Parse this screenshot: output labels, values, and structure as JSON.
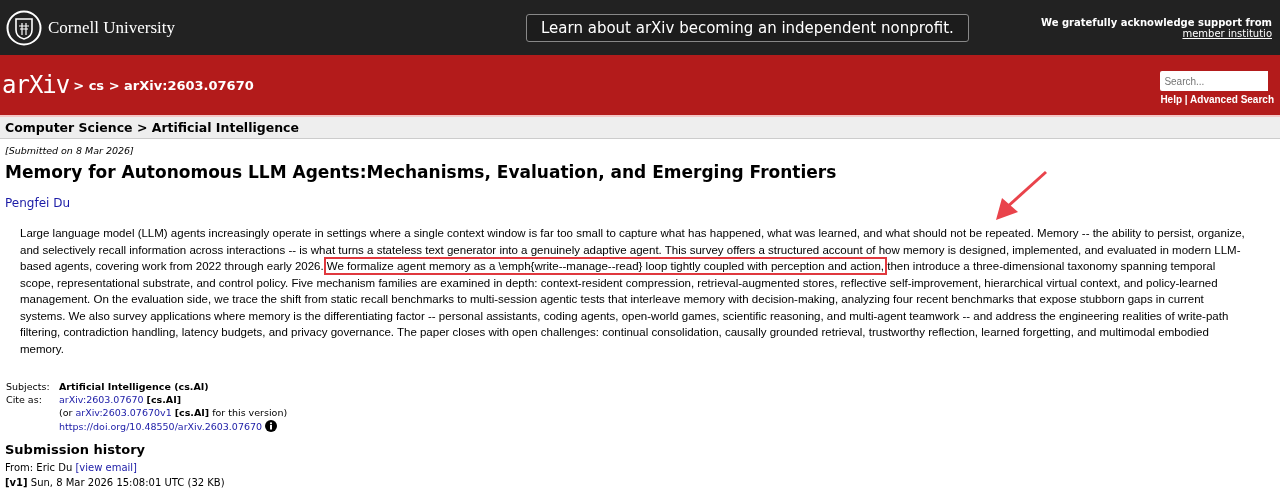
{
  "top_bar": {
    "university": "Cornell University",
    "announcement": "Learn about arXiv becoming an independent nonprofit.",
    "support_text": "We gratefully acknowledge support from",
    "support_link": "member institutio"
  },
  "header": {
    "logo": "arXiv",
    "breadcrumb": "> cs > arXiv:2603.07670",
    "search": {
      "placeholder": "Search..."
    },
    "links": [
      {
        "label": "Help"
      },
      {
        "label": "Advanced Search"
      }
    ],
    "link_separator": "|"
  },
  "subheader": "Computer Science > Artificial Intelligence",
  "dateline": "[Submitted on 8 Mar 2026]",
  "title": "Memory for Autonomous LLM Agents:Mechanisms, Evaluation, and Emerging Frontiers",
  "authors": [
    "Pengfei Du"
  ],
  "abstract": {
    "before": "Large language model (LLM) agents increasingly operate in settings where a single context window is far too small to capture what has happened, what was learned, and what should not be repeated. Memory -- the ability to persist, organize, and selectively recall information across interactions -- is what turns a stateless text generator into a genuinely adaptive agent. This survey offers a structured account of how memory is designed, implemented, and evaluated in modern LLM-based agents, covering work from 2022 through early 2026.",
    "highlighted": "We formalize agent memory as a \\emph{write--manage--read} loop tightly coupled with perception and action,",
    "after": "then introduce a three-dimensional taxonomy spanning temporal scope, representational substrate, and control policy. Five mechanism families are examined in depth: context-resident compression, retrieval-augmented stores, reflective self-improvement, hierarchical virtual context, and policy-learned management. On the evaluation side, we trace the shift from static recall benchmarks to multi-session agentic tests that interleave memory with decision-making, analyzing four recent benchmarks that expose stubborn gaps in current systems. We also survey applications where memory is the differentiating factor -- personal assistants, coding agents, open-world games, scientific reasoning, and multi-agent teamwork -- and address the engineering realities of write-path filtering, contradiction handling, latency budgets, and privacy governance. The paper closes with open challenges: continual consolidation, causally grounded retrieval, trustworthy reflection, learned forgetting, and multimodal embodied memory."
  },
  "metadata": {
    "subjects_label": "Subjects:",
    "subjects": "Artificial Intelligence (cs.AI)",
    "cite_label": "Cite as:",
    "cite_lines": [
      {
        "kind": "primary",
        "link": "arXiv:2603.07670",
        "tag": "[cs.AI]"
      },
      {
        "kind": "version",
        "prefix": "(or",
        "link": "arXiv:2603.07670v1",
        "tag": "[cs.AI]",
        "suffix": "for this version)"
      },
      {
        "kind": "doi",
        "link": "https://doi.org/10.48550/arXiv.2603.07670"
      }
    ]
  },
  "submission_history": {
    "heading": "Submission history",
    "from_label": "From: Eric Du",
    "email_link": "[view email]",
    "versions": [
      "**[v1]** Sun, 8 Mar 2026 15:08:01 UTC (32 KB)"
    ]
  }
}
